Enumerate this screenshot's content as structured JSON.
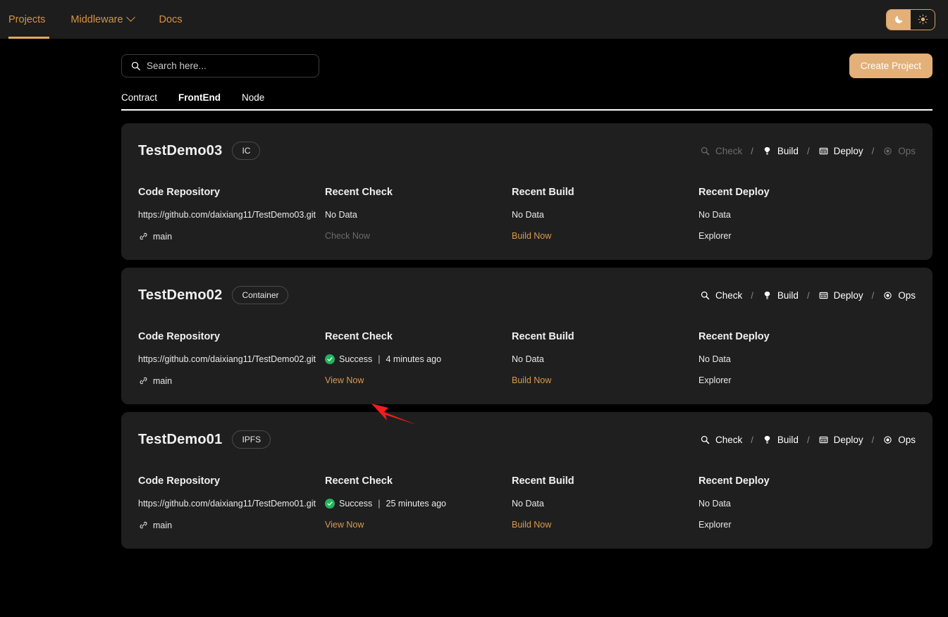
{
  "nav": {
    "items": [
      {
        "label": "Projects",
        "icon": "none",
        "active": true
      },
      {
        "label": "Middleware",
        "icon": "chevron-down-icon",
        "active": false
      },
      {
        "label": "Docs",
        "icon": "none",
        "active": false
      }
    ],
    "theme_toggle": {
      "dark_icon": "moon-icon",
      "light_icon": "sun-icon",
      "selected": "dark"
    }
  },
  "search": {
    "placeholder": "Search here...",
    "value": "",
    "icon": "search-icon"
  },
  "toolbar": {
    "create_label": "Create Project"
  },
  "tabs": {
    "items": [
      {
        "label": "Contract",
        "active": false
      },
      {
        "label": "FrontEnd",
        "active": true
      },
      {
        "label": "Node",
        "active": false
      }
    ]
  },
  "column_titles": {
    "repo": "Code Repository",
    "check": "Recent Check",
    "build": "Recent Build",
    "deploy": "Recent Deploy"
  },
  "action_labels": {
    "check": "Check",
    "build": "Build",
    "deploy": "Deploy",
    "ops": "Ops",
    "separator": "/"
  },
  "action_icons": {
    "check": "magnifier-icon",
    "build": "hammer-icon",
    "deploy": "server-rack-icon",
    "ops": "target-icon"
  },
  "cards": [
    {
      "title": "TestDemo03",
      "badge": "IC",
      "actions": {
        "check_enabled": false,
        "build_enabled": true,
        "deploy_enabled": true,
        "ops_enabled": false
      },
      "repo_url": "https://github.com/daixiang11/TestDemo03.git",
      "branch": "main",
      "branch_icon": "git-branch-icon",
      "check_status": "No Data",
      "check_action": "Check Now",
      "check_action_enabled": false,
      "check_success": false,
      "build_status": "No Data",
      "build_action": "Build Now",
      "deploy_status": "No Data",
      "deploy_action": "Explorer"
    },
    {
      "title": "TestDemo02",
      "badge": "Container",
      "actions": {
        "check_enabled": true,
        "build_enabled": true,
        "deploy_enabled": true,
        "ops_enabled": true
      },
      "repo_url": "https://github.com/daixiang11/TestDemo02.git",
      "branch": "main",
      "branch_icon": "git-branch-icon",
      "check_status": "Success",
      "check_time": "4 minutes ago",
      "check_action": "View Now",
      "check_action_enabled": true,
      "check_success": true,
      "build_status": "No Data",
      "build_action": "Build Now",
      "deploy_status": "No Data",
      "deploy_action": "Explorer"
    },
    {
      "title": "TestDemo01",
      "badge": "IPFS",
      "actions": {
        "check_enabled": true,
        "build_enabled": true,
        "deploy_enabled": true,
        "ops_enabled": true
      },
      "repo_url": "https://github.com/daixiang11/TestDemo01.git",
      "branch": "main",
      "branch_icon": "git-branch-icon",
      "check_status": "Success",
      "check_time": "25 minutes ago",
      "check_action": "View Now",
      "check_action_enabled": true,
      "check_success": true,
      "build_status": "No Data",
      "build_action": "Build Now",
      "deploy_status": "No Data",
      "deploy_action": "Explorer"
    }
  ],
  "annotation": {
    "arrow_color": "#f21c1c",
    "points_at": "View Now"
  },
  "colors": {
    "page_bg": "#000000",
    "card_bg": "#1f1f1f",
    "accent": "#d99a4e",
    "accent_fill": "#e3b07a",
    "success": "#22b35e",
    "muted": "#6b6b6b"
  }
}
